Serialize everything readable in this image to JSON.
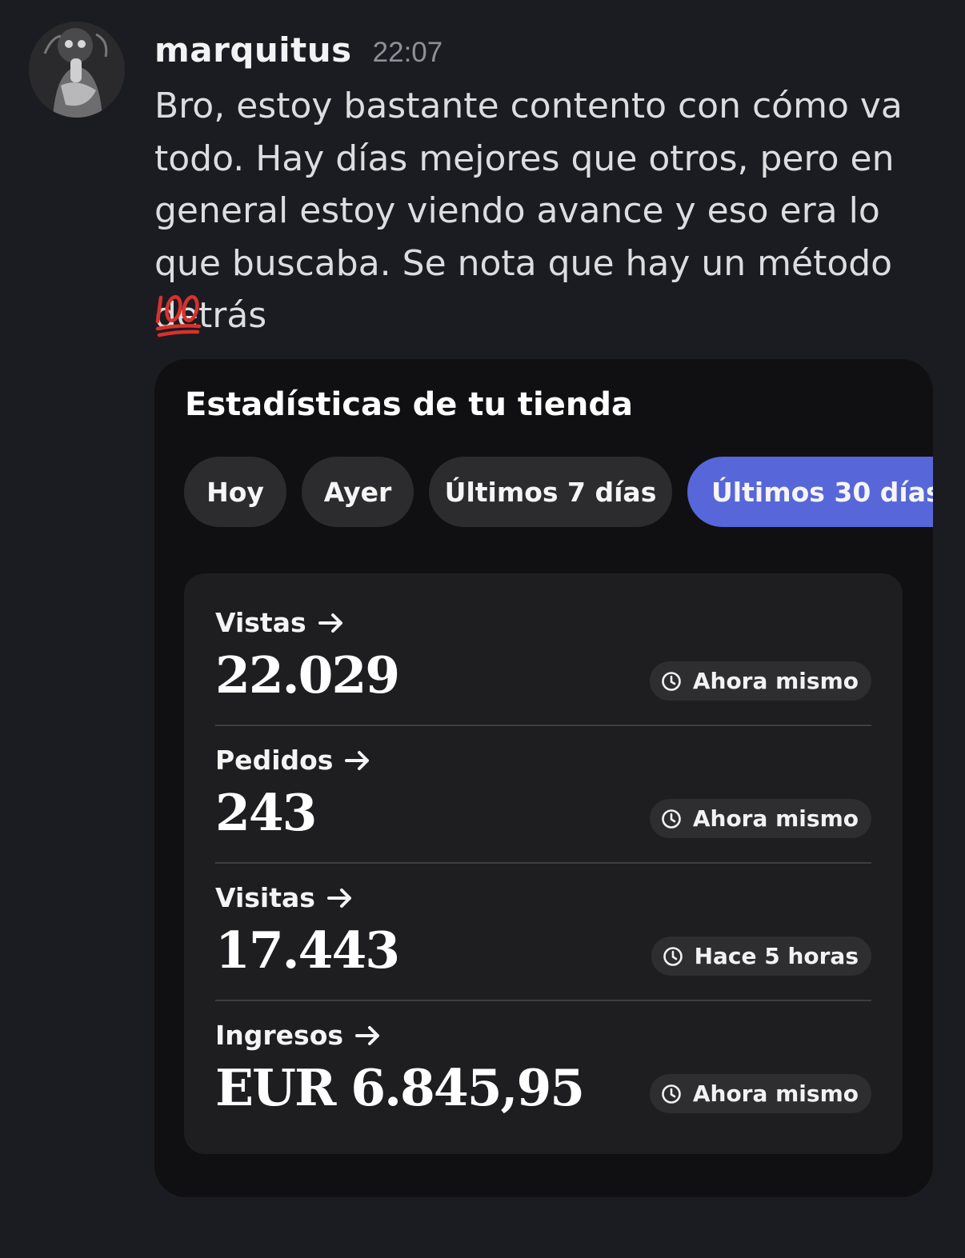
{
  "message": {
    "username": "marquitus",
    "timestamp": "22:07",
    "text": "Bro, estoy bastante contento con cómo va todo. Hay días mejores que otros, pero en general estoy viendo avance y eso era lo que buscaba. Se nota que hay un método detrás",
    "emoji": "100-emoji"
  },
  "card": {
    "title": "Estadísticas de tu tienda",
    "filters": [
      {
        "label": "Hoy",
        "active": false
      },
      {
        "label": "Ayer",
        "active": false
      },
      {
        "label": "Últimos 7 días",
        "active": false
      },
      {
        "label": "Últimos 30 días",
        "active": true
      }
    ],
    "active_color": "#5766d8",
    "stats": [
      {
        "label": "Vistas",
        "value": "22.029",
        "updated": "Ahora mismo"
      },
      {
        "label": "Pedidos",
        "value": "243",
        "updated": "Ahora mismo"
      },
      {
        "label": "Visitas",
        "value": "17.443",
        "updated": "Hace 5 horas"
      },
      {
        "label": "Ingresos",
        "value": "EUR 6.845,95",
        "updated": "Ahora mismo"
      }
    ]
  }
}
